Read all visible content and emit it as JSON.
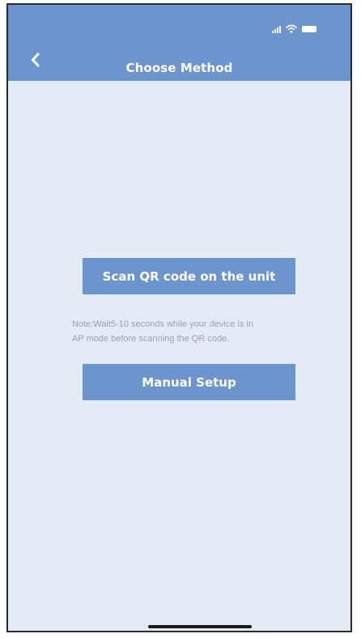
{
  "header": {
    "title": "Choose Method",
    "back_icon": "chevron-left-icon",
    "background_color": "#6d95cd"
  },
  "status_bar": {
    "icons": [
      "signal-icon",
      "wifi-icon",
      "battery-icon"
    ]
  },
  "main": {
    "background_color": "#e3ecf5",
    "scan_button_label": "Scan QR code on the unit",
    "note": "Note:Wait5-10 seconds while your device is in\nAP mode before scanning the QR code.",
    "manual_button_label": "Manual Setup"
  }
}
